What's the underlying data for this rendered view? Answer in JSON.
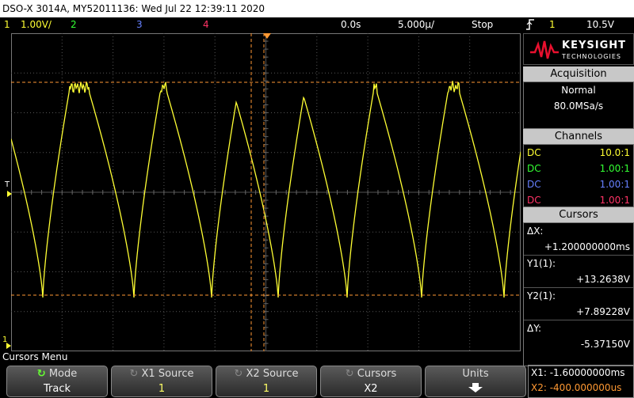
{
  "title_bar": "DSO-X 3014A, MY52011136: Wed Jul 22 12:39:11 2020",
  "status": {
    "ch1_num": "1",
    "ch1_scale": "1.00V/",
    "ch2_num": "2",
    "ch3_num": "3",
    "ch4_num": "4",
    "delay": "0.0s",
    "timebase": "5.000µ/",
    "run_state": "Stop",
    "trigger_icon": "trigger-edge-icon",
    "trigger_ch": "1",
    "trigger_level": "10.5V"
  },
  "markers": {
    "trigger_label": "T",
    "ground_label": "1"
  },
  "logo": {
    "brand": "KEYSIGHT",
    "sub": "TECHNOLOGIES"
  },
  "acquisition": {
    "header": "Acquisition",
    "mode": "Normal",
    "rate": "80.0MSa/s"
  },
  "channels": {
    "header": "Channels",
    "rows": [
      {
        "coupling": "DC",
        "probe": "10.0:1",
        "color": "#ffff33"
      },
      {
        "coupling": "DC",
        "probe": "1.00:1",
        "color": "#33ff33"
      },
      {
        "coupling": "DC",
        "probe": "1.00:1",
        "color": "#6680ff"
      },
      {
        "coupling": "DC",
        "probe": "1.00:1",
        "color": "#ff3366"
      }
    ]
  },
  "cursors": {
    "header": "Cursors",
    "dx_label": "ΔX:",
    "dx_value": "+1.200000000ms",
    "y1_label": "Y1(1):",
    "y1_value": "+13.2638V",
    "y2_label": "Y2(1):",
    "y2_value": "+7.89228V",
    "dy_label": "ΔY:",
    "dy_value": "-5.37150V"
  },
  "menu": {
    "title": "Cursors Menu",
    "keys": [
      {
        "label": "Mode",
        "value": "Track"
      },
      {
        "label": "X1 Source",
        "value": "1"
      },
      {
        "label": "X2 Source",
        "value": "1"
      },
      {
        "label": "Cursors",
        "value": "X2"
      },
      {
        "label": "Units",
        "value": ""
      }
    ]
  },
  "readout": {
    "x1": "X1: -1.60000000ms",
    "x2": "X2: -400.000000us"
  },
  "colors": {
    "ch1": "#ffff33",
    "cursor": "#ff9933",
    "accent": "#ff6600"
  }
}
